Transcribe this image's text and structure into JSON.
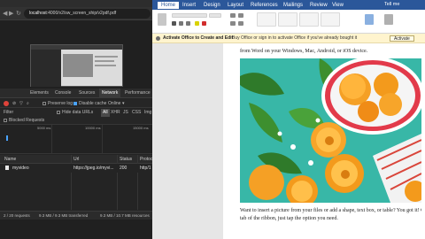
{
  "browser": {
    "url_host": "localhost",
    "url_path": ":4000/v2/sw_screen_ship/v2pdf.pdf",
    "nav_back": "◀",
    "nav_forward": "▶",
    "nav_reload": "↻"
  },
  "devtools": {
    "tabs": [
      "Elements",
      "Console",
      "Sources",
      "Network",
      "Performance"
    ],
    "active_tab": "Network",
    "toolbar": {
      "preserve_log": "Preserve log",
      "disable_cache": "Disable cache",
      "online": "Online"
    },
    "filter": {
      "label": "Filter",
      "hide_data_urls": "Hide data URLs",
      "types": [
        "All",
        "XHR",
        "JS",
        "CSS",
        "Img"
      ]
    },
    "blocked_requests": "Blocked Requests",
    "timeline_ticks": [
      "5000 ms",
      "10000 ms",
      "15000 ms"
    ],
    "table": {
      "headers": [
        "Name",
        "Url",
        "Status",
        "Protoc"
      ],
      "rows": [
        {
          "name": "myvideo",
          "url": "https://jpeg.io/myvi...",
          "status": "200",
          "protocol": "http/1"
        }
      ]
    },
    "status": {
      "requests": "2 / 20 requests",
      "transferred": "9.3 MB / 9.3 MB transferred",
      "resources": "9.3 MB / 10.7 MB resources"
    }
  },
  "word": {
    "tabs": [
      "Home",
      "Insert",
      "Design",
      "Layout",
      "References",
      "Mailings",
      "Review",
      "View"
    ],
    "active_tab": "Home",
    "title_right": "Tell me",
    "notice": {
      "title": "Activate Office to Create and Edit",
      "message": "Buy Office or sign in to activate Office if you've already bought it",
      "button": "Activate"
    },
    "doc_text_top": "from Word on your Windows, Mac, Android, or iOS device.",
    "doc_text_bottom_1": "Want to insert a picture from your files or add a shape, text box, or table? You got it! On the",
    "doc_text_bottom_2": "tab of the ribbon, just tap the option you need."
  },
  "colors": {
    "word_blue": "#2b579a",
    "notice_bg": "#fff4ce",
    "record_red": "#e0433a",
    "photo_teal": "#38b7a7",
    "apricot": "#f5a025"
  }
}
